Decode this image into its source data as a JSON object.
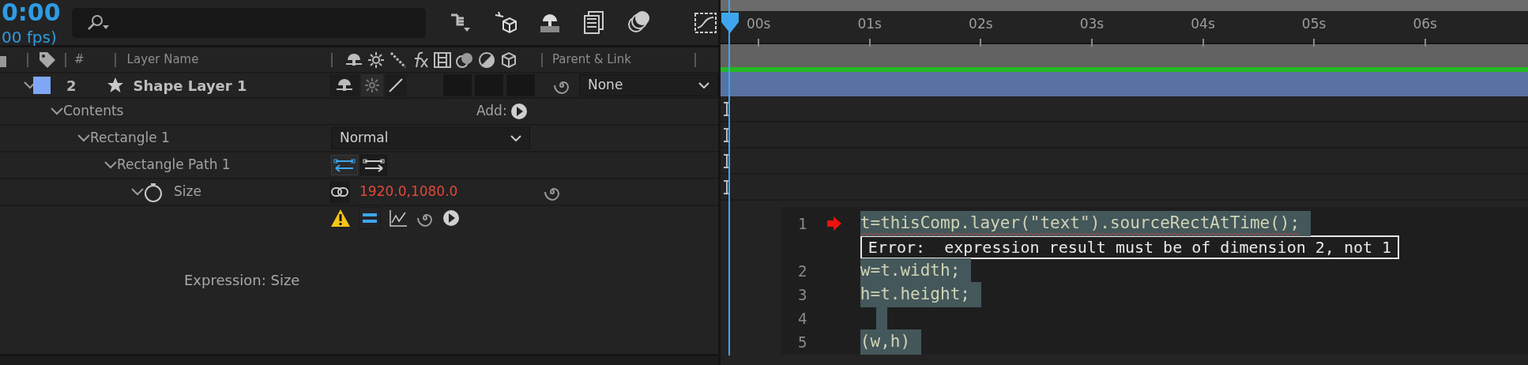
{
  "timecode": {
    "time": "0:00",
    "fps": "00 fps)"
  },
  "columns": {
    "number": "#",
    "name": "Layer Name",
    "parent": "Parent & Link"
  },
  "layer": {
    "number": "2",
    "name": "Shape Layer 1",
    "color": "#7fa7f5",
    "expanded": true,
    "parent": "None",
    "switches": [
      {
        "on": true
      },
      {
        "on": false
      },
      {
        "on": true
      }
    ],
    "toggles": [
      {
        "on": false
      },
      {
        "on": false
      },
      {
        "on": false
      }
    ]
  },
  "tree": [
    {
      "kind": "group",
      "name": "Contents",
      "expanded": true,
      "add_label": "Add:",
      "children": [
        {
          "kind": "group",
          "name": "Rectangle 1",
          "expanded": true,
          "blend_mode": "Normal",
          "children": [
            {
              "kind": "path",
              "name": "Rectangle Path 1",
              "expanded": true,
              "directions": [
                {
                  "selected": true
                },
                {
                  "selected": false
                }
              ],
              "children": [
                {
                  "kind": "property",
                  "name": "Size",
                  "expanded": true,
                  "value": "1920.0,1080.0",
                  "expression": {
                    "label": "Expression: Size",
                    "warning": true,
                    "enabled": true
                  }
                }
              ]
            }
          ]
        }
      ]
    }
  ],
  "ruler": [
    "00s",
    "01s",
    "02s",
    "03s",
    "04s",
    "05s",
    "06s"
  ],
  "code": {
    "lines": [
      {
        "number": "1",
        "text": "t=thisComp.layer(\"text\").sourceRectAtTime();",
        "error": true,
        "selected": true
      },
      {
        "number": "2",
        "text": "w=t.width;",
        "error": false,
        "selected": true
      },
      {
        "number": "3",
        "text": "h=t.height;",
        "error": false,
        "selected": true
      },
      {
        "number": "4",
        "error": false,
        "selected": true
      },
      {
        "number": "5",
        "text": "(w,h)",
        "error": false,
        "selected": true
      }
    ],
    "error_message": "Error:  expression result must be of dimension 2, not 1"
  }
}
